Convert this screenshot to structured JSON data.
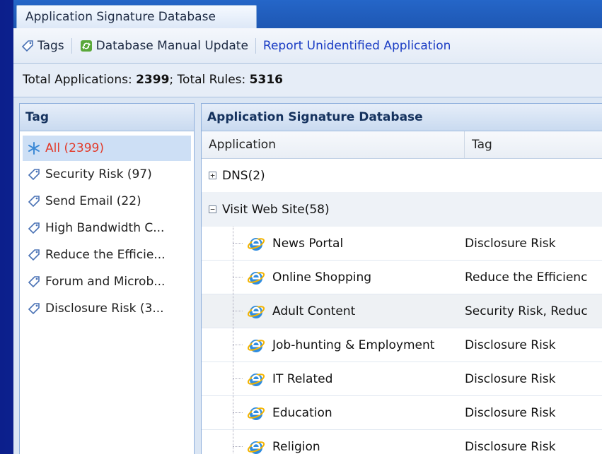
{
  "tab": {
    "label": "Application Signature Database"
  },
  "toolbar": {
    "tags_label": "Tags",
    "update_label": "Database Manual Update",
    "report_label": "Report Unidentified Application"
  },
  "status": {
    "apps_prefix": "Total Applications: ",
    "apps_count": "2399",
    "rules_prefix": "; Total Rules: ",
    "rules_count": "5316"
  },
  "left_panel": {
    "title": "Tag",
    "items": [
      {
        "label": "All (2399)"
      },
      {
        "label": "Security Risk (97)"
      },
      {
        "label": "Send Email (22)"
      },
      {
        "label": "High Bandwidth C..."
      },
      {
        "label": "Reduce the Efficie..."
      },
      {
        "label": "Forum and Microb..."
      },
      {
        "label": "Disclosure Risk (3..."
      }
    ]
  },
  "right_panel": {
    "title": "Application Signature Database",
    "columns": {
      "application": "Application",
      "tag": "Tag"
    },
    "groups": [
      {
        "label": "DNS(2)",
        "expander": "+"
      },
      {
        "label": "Visit Web Site(58)",
        "expander": "−"
      }
    ],
    "rows": [
      {
        "app": "News Portal",
        "tag": "Disclosure Risk"
      },
      {
        "app": "Online Shopping",
        "tag": "Reduce the Efficienc"
      },
      {
        "app": "Adult Content",
        "tag": "Security Risk, Reduc"
      },
      {
        "app": "Job-hunting & Employment",
        "tag": "Disclosure Risk"
      },
      {
        "app": "IT Related",
        "tag": "Disclosure Risk"
      },
      {
        "app": "Education",
        "tag": "Disclosure Risk"
      },
      {
        "app": "Religion",
        "tag": "Disclosure Risk"
      }
    ]
  },
  "colors": {
    "desktop": "#0c1f8c",
    "active_tag_text": "#e23b2b",
    "link": "#1a3cc4",
    "header_text": "#15325e"
  }
}
